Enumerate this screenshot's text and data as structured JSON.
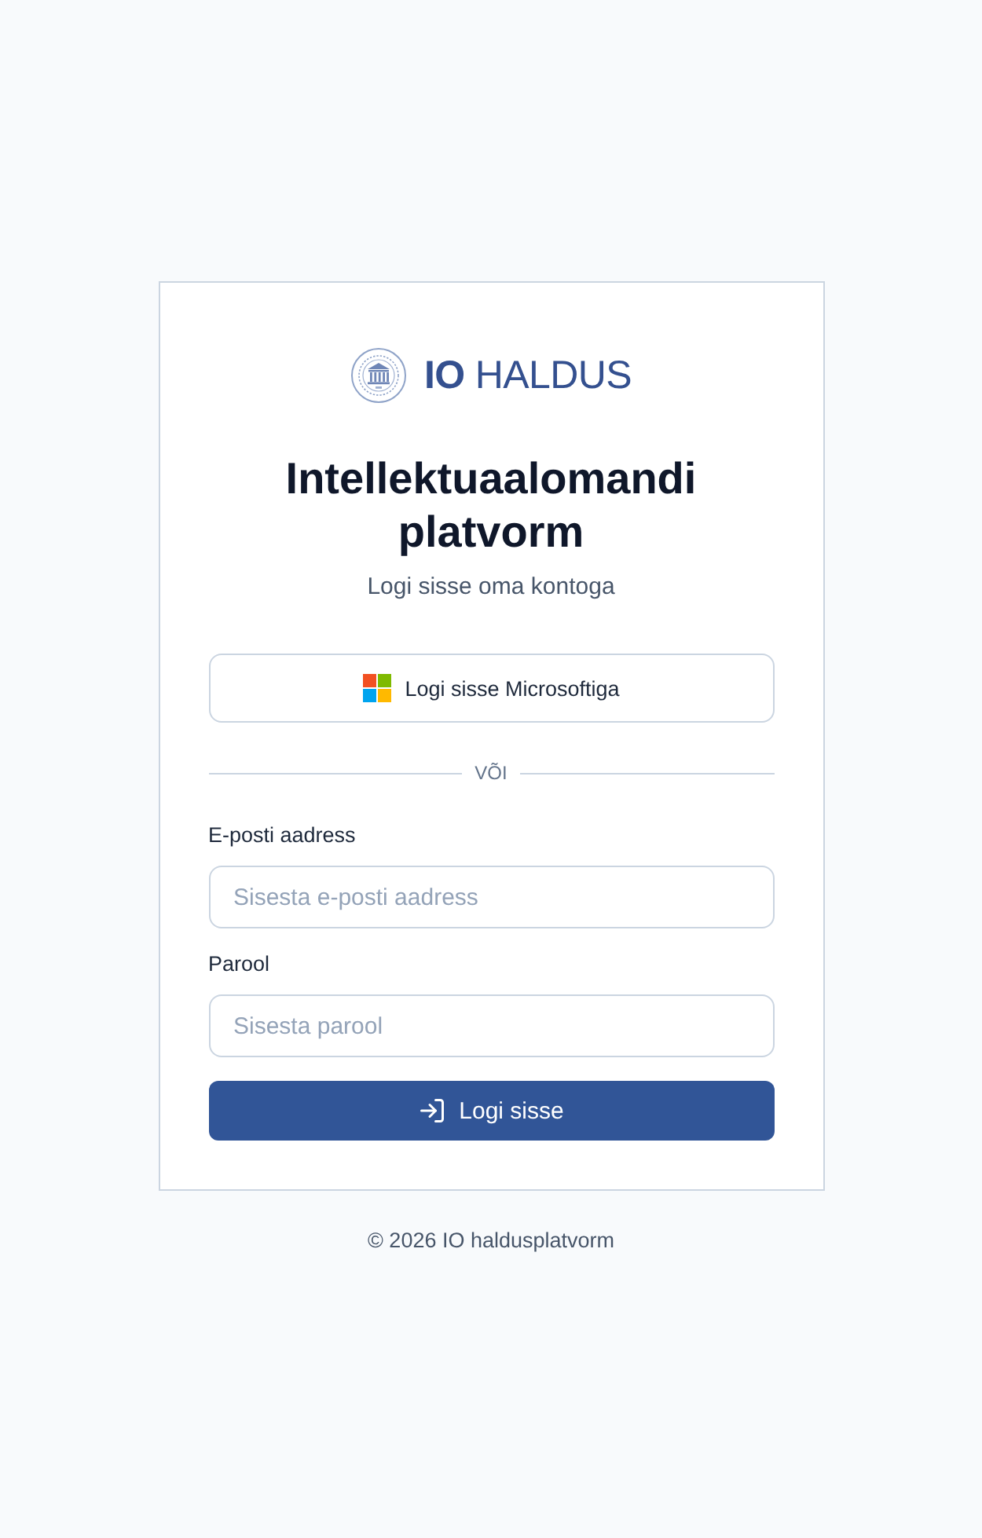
{
  "logo": {
    "wordmark": "**IO** HALDUS"
  },
  "title": "Intellektuaalomandi platvorm",
  "subtitle": "Logi sisse oma kontoga",
  "microsoft_button": {
    "label": "Logi sisse Microsoftiga"
  },
  "divider": {
    "label": "VÕI"
  },
  "fields": [
    {
      "label": "E-posti aadress",
      "placeholder": "Sisesta e-posti aadress"
    },
    {
      "label": "Parool",
      "placeholder": "Sisesta parool"
    }
  ],
  "submit_button": {
    "label": "Logi sisse"
  },
  "footer": "© 2026 IO haldusplatvorm"
}
